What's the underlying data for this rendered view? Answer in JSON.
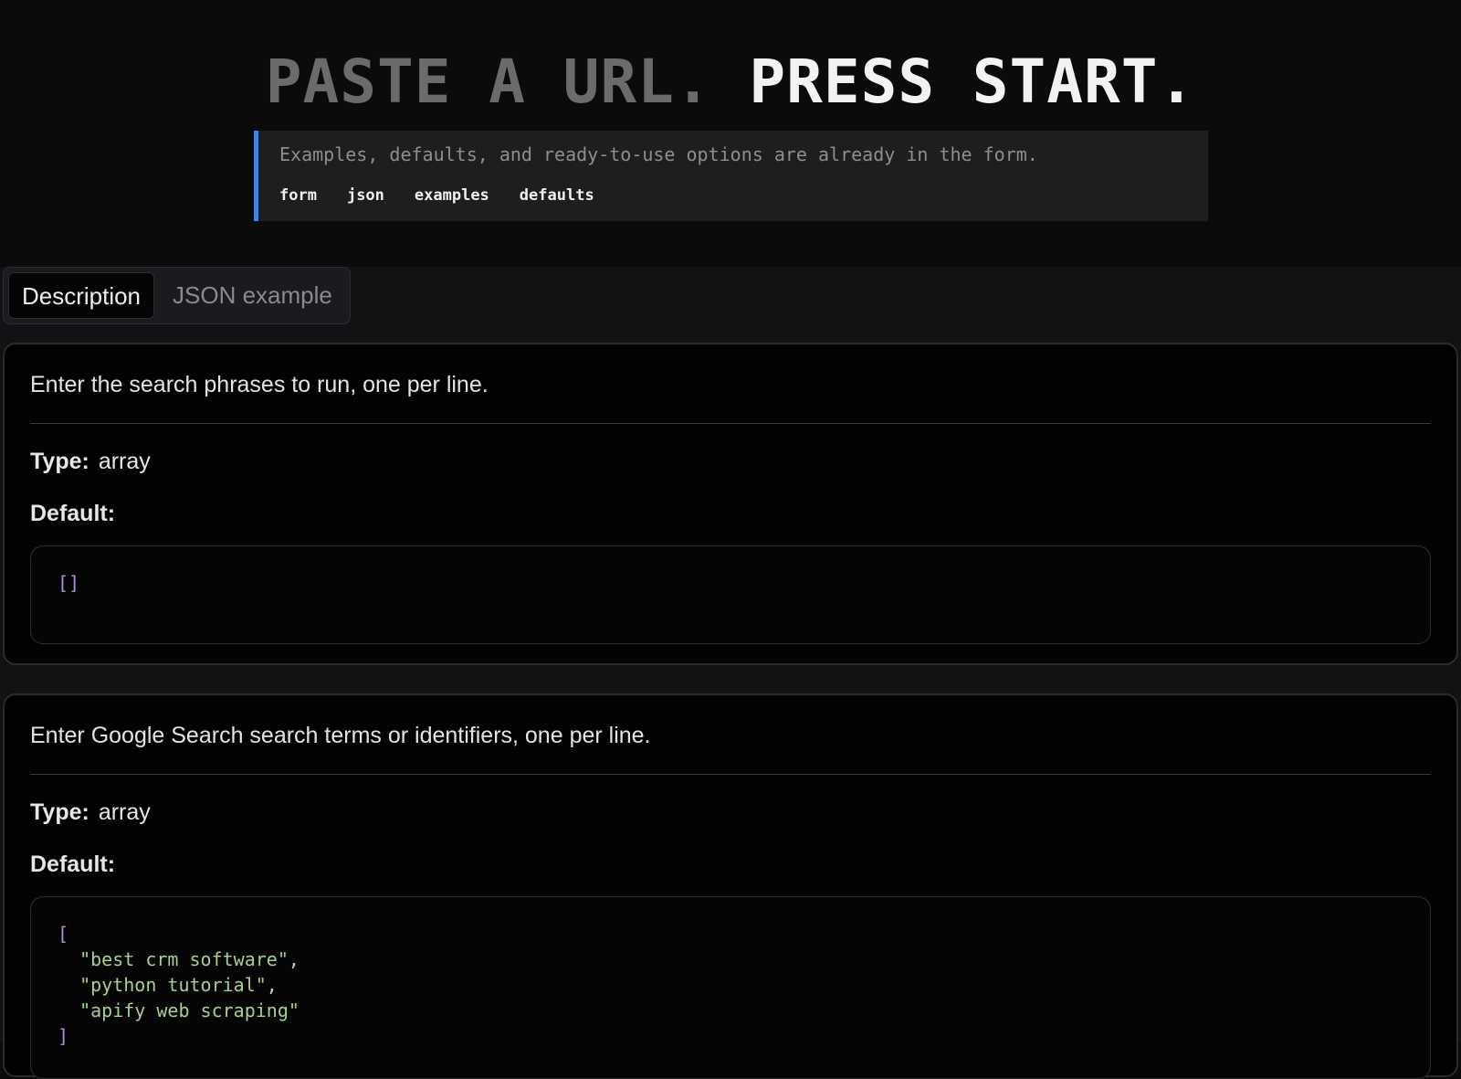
{
  "hero": {
    "headline_dim": "PASTE A URL.",
    "headline_bright": "PRESS START.",
    "callout_text": "Examples, defaults, and ready-to-use options are already in the form.",
    "tags": [
      "form",
      "json",
      "examples",
      "defaults"
    ]
  },
  "tabs": {
    "active_label": "Description",
    "inactive_label": "JSON example"
  },
  "fields": [
    {
      "description": "Enter the search phrases to run, one per line.",
      "type_label": "Type:",
      "type_value": "array",
      "default_label": "Default:",
      "default_code_open": "[]"
    },
    {
      "description": "Enter Google Search search terms or identifiers, one per line.",
      "type_label": "Type:",
      "type_value": "array",
      "default_label": "Default:",
      "default_code_open": "[",
      "default_items": [
        "\"best crm software\"",
        "\"python tutorial\"",
        "\"apify web scraping\""
      ],
      "default_code_close": "]"
    }
  ],
  "colors": {
    "accent": "#3b82f6",
    "code_bracket": "#b48ede",
    "code_string": "#a8d190"
  }
}
